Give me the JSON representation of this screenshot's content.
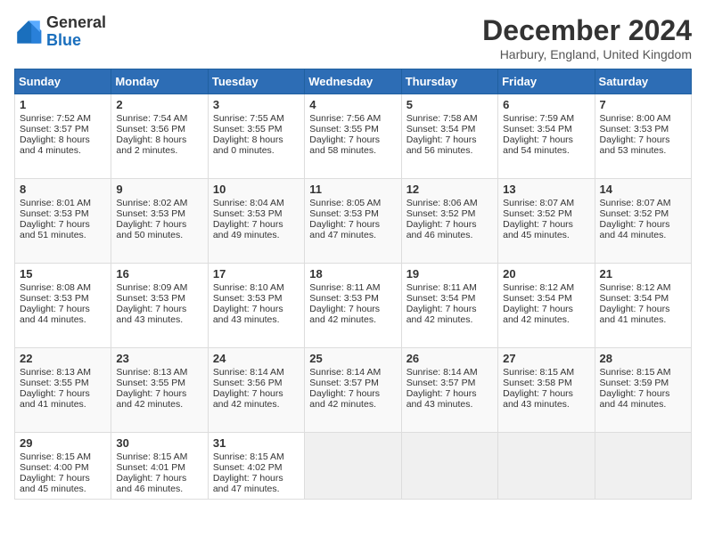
{
  "header": {
    "logo_general": "General",
    "logo_blue": "Blue",
    "month_title": "December 2024",
    "subtitle": "Harbury, England, United Kingdom"
  },
  "days_of_week": [
    "Sunday",
    "Monday",
    "Tuesday",
    "Wednesday",
    "Thursday",
    "Friday",
    "Saturday"
  ],
  "weeks": [
    [
      {
        "day": 1,
        "lines": [
          "Sunrise: 7:52 AM",
          "Sunset: 3:57 PM",
          "Daylight: 8 hours",
          "and 4 minutes."
        ]
      },
      {
        "day": 2,
        "lines": [
          "Sunrise: 7:54 AM",
          "Sunset: 3:56 PM",
          "Daylight: 8 hours",
          "and 2 minutes."
        ]
      },
      {
        "day": 3,
        "lines": [
          "Sunrise: 7:55 AM",
          "Sunset: 3:55 PM",
          "Daylight: 8 hours",
          "and 0 minutes."
        ]
      },
      {
        "day": 4,
        "lines": [
          "Sunrise: 7:56 AM",
          "Sunset: 3:55 PM",
          "Daylight: 7 hours",
          "and 58 minutes."
        ]
      },
      {
        "day": 5,
        "lines": [
          "Sunrise: 7:58 AM",
          "Sunset: 3:54 PM",
          "Daylight: 7 hours",
          "and 56 minutes."
        ]
      },
      {
        "day": 6,
        "lines": [
          "Sunrise: 7:59 AM",
          "Sunset: 3:54 PM",
          "Daylight: 7 hours",
          "and 54 minutes."
        ]
      },
      {
        "day": 7,
        "lines": [
          "Sunrise: 8:00 AM",
          "Sunset: 3:53 PM",
          "Daylight: 7 hours",
          "and 53 minutes."
        ]
      }
    ],
    [
      {
        "day": 8,
        "lines": [
          "Sunrise: 8:01 AM",
          "Sunset: 3:53 PM",
          "Daylight: 7 hours",
          "and 51 minutes."
        ]
      },
      {
        "day": 9,
        "lines": [
          "Sunrise: 8:02 AM",
          "Sunset: 3:53 PM",
          "Daylight: 7 hours",
          "and 50 minutes."
        ]
      },
      {
        "day": 10,
        "lines": [
          "Sunrise: 8:04 AM",
          "Sunset: 3:53 PM",
          "Daylight: 7 hours",
          "and 49 minutes."
        ]
      },
      {
        "day": 11,
        "lines": [
          "Sunrise: 8:05 AM",
          "Sunset: 3:53 PM",
          "Daylight: 7 hours",
          "and 47 minutes."
        ]
      },
      {
        "day": 12,
        "lines": [
          "Sunrise: 8:06 AM",
          "Sunset: 3:52 PM",
          "Daylight: 7 hours",
          "and 46 minutes."
        ]
      },
      {
        "day": 13,
        "lines": [
          "Sunrise: 8:07 AM",
          "Sunset: 3:52 PM",
          "Daylight: 7 hours",
          "and 45 minutes."
        ]
      },
      {
        "day": 14,
        "lines": [
          "Sunrise: 8:07 AM",
          "Sunset: 3:52 PM",
          "Daylight: 7 hours",
          "and 44 minutes."
        ]
      }
    ],
    [
      {
        "day": 15,
        "lines": [
          "Sunrise: 8:08 AM",
          "Sunset: 3:53 PM",
          "Daylight: 7 hours",
          "and 44 minutes."
        ]
      },
      {
        "day": 16,
        "lines": [
          "Sunrise: 8:09 AM",
          "Sunset: 3:53 PM",
          "Daylight: 7 hours",
          "and 43 minutes."
        ]
      },
      {
        "day": 17,
        "lines": [
          "Sunrise: 8:10 AM",
          "Sunset: 3:53 PM",
          "Daylight: 7 hours",
          "and 43 minutes."
        ]
      },
      {
        "day": 18,
        "lines": [
          "Sunrise: 8:11 AM",
          "Sunset: 3:53 PM",
          "Daylight: 7 hours",
          "and 42 minutes."
        ]
      },
      {
        "day": 19,
        "lines": [
          "Sunrise: 8:11 AM",
          "Sunset: 3:54 PM",
          "Daylight: 7 hours",
          "and 42 minutes."
        ]
      },
      {
        "day": 20,
        "lines": [
          "Sunrise: 8:12 AM",
          "Sunset: 3:54 PM",
          "Daylight: 7 hours",
          "and 42 minutes."
        ]
      },
      {
        "day": 21,
        "lines": [
          "Sunrise: 8:12 AM",
          "Sunset: 3:54 PM",
          "Daylight: 7 hours",
          "and 41 minutes."
        ]
      }
    ],
    [
      {
        "day": 22,
        "lines": [
          "Sunrise: 8:13 AM",
          "Sunset: 3:55 PM",
          "Daylight: 7 hours",
          "and 41 minutes."
        ]
      },
      {
        "day": 23,
        "lines": [
          "Sunrise: 8:13 AM",
          "Sunset: 3:55 PM",
          "Daylight: 7 hours",
          "and 42 minutes."
        ]
      },
      {
        "day": 24,
        "lines": [
          "Sunrise: 8:14 AM",
          "Sunset: 3:56 PM",
          "Daylight: 7 hours",
          "and 42 minutes."
        ]
      },
      {
        "day": 25,
        "lines": [
          "Sunrise: 8:14 AM",
          "Sunset: 3:57 PM",
          "Daylight: 7 hours",
          "and 42 minutes."
        ]
      },
      {
        "day": 26,
        "lines": [
          "Sunrise: 8:14 AM",
          "Sunset: 3:57 PM",
          "Daylight: 7 hours",
          "and 43 minutes."
        ]
      },
      {
        "day": 27,
        "lines": [
          "Sunrise: 8:15 AM",
          "Sunset: 3:58 PM",
          "Daylight: 7 hours",
          "and 43 minutes."
        ]
      },
      {
        "day": 28,
        "lines": [
          "Sunrise: 8:15 AM",
          "Sunset: 3:59 PM",
          "Daylight: 7 hours",
          "and 44 minutes."
        ]
      }
    ],
    [
      {
        "day": 29,
        "lines": [
          "Sunrise: 8:15 AM",
          "Sunset: 4:00 PM",
          "Daylight: 7 hours",
          "and 45 minutes."
        ]
      },
      {
        "day": 30,
        "lines": [
          "Sunrise: 8:15 AM",
          "Sunset: 4:01 PM",
          "Daylight: 7 hours",
          "and 46 minutes."
        ]
      },
      {
        "day": 31,
        "lines": [
          "Sunrise: 8:15 AM",
          "Sunset: 4:02 PM",
          "Daylight: 7 hours",
          "and 47 minutes."
        ]
      },
      null,
      null,
      null,
      null
    ]
  ]
}
